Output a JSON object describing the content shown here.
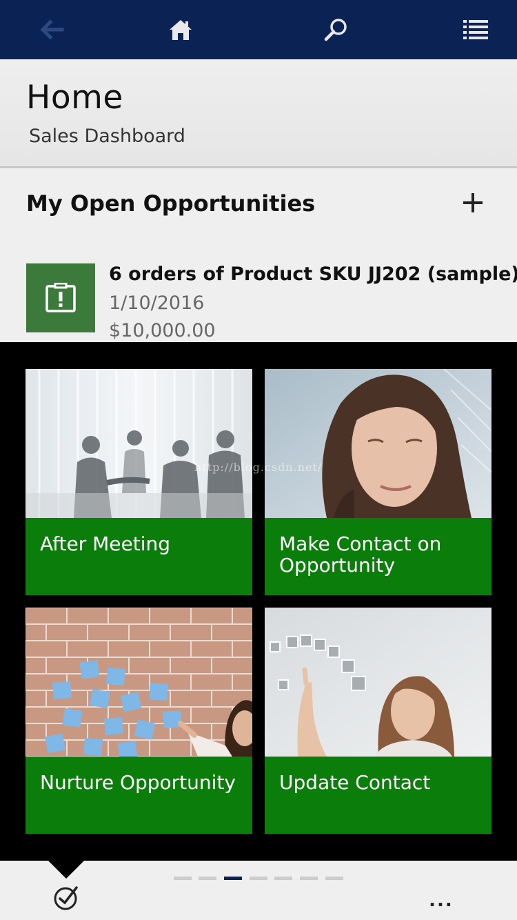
{
  "colors": {
    "nav_bar": "#0b2354",
    "tile_green": "#0b7d0b",
    "opportunity_icon_bg": "#3c7a3c",
    "overlay": "#000000"
  },
  "nav": {
    "back_icon": "arrow-left-icon",
    "home_icon": "home-icon",
    "search_icon": "search-icon",
    "menu_icon": "list-icon"
  },
  "header": {
    "title": "Home",
    "subtitle": "Sales Dashboard"
  },
  "opportunities": {
    "section_title": "My Open Opportunities",
    "add_icon": "plus-icon",
    "items": [
      {
        "name": "6 orders of Product SKU JJ202 (sample)",
        "date": "1/10/2016",
        "amount": "$10,000.00"
      }
    ]
  },
  "tiles": [
    {
      "label": "After Meeting"
    },
    {
      "label": "Make Contact on Opportunity"
    },
    {
      "label": "Nurture Opportunity"
    },
    {
      "label": "Update Contact"
    }
  ],
  "watermark": "http://blog.csdn.net/",
  "bottom_bar": {
    "task_icon": "circle-check-icon",
    "pages": 7,
    "active_page": 3,
    "more_label": "..."
  }
}
